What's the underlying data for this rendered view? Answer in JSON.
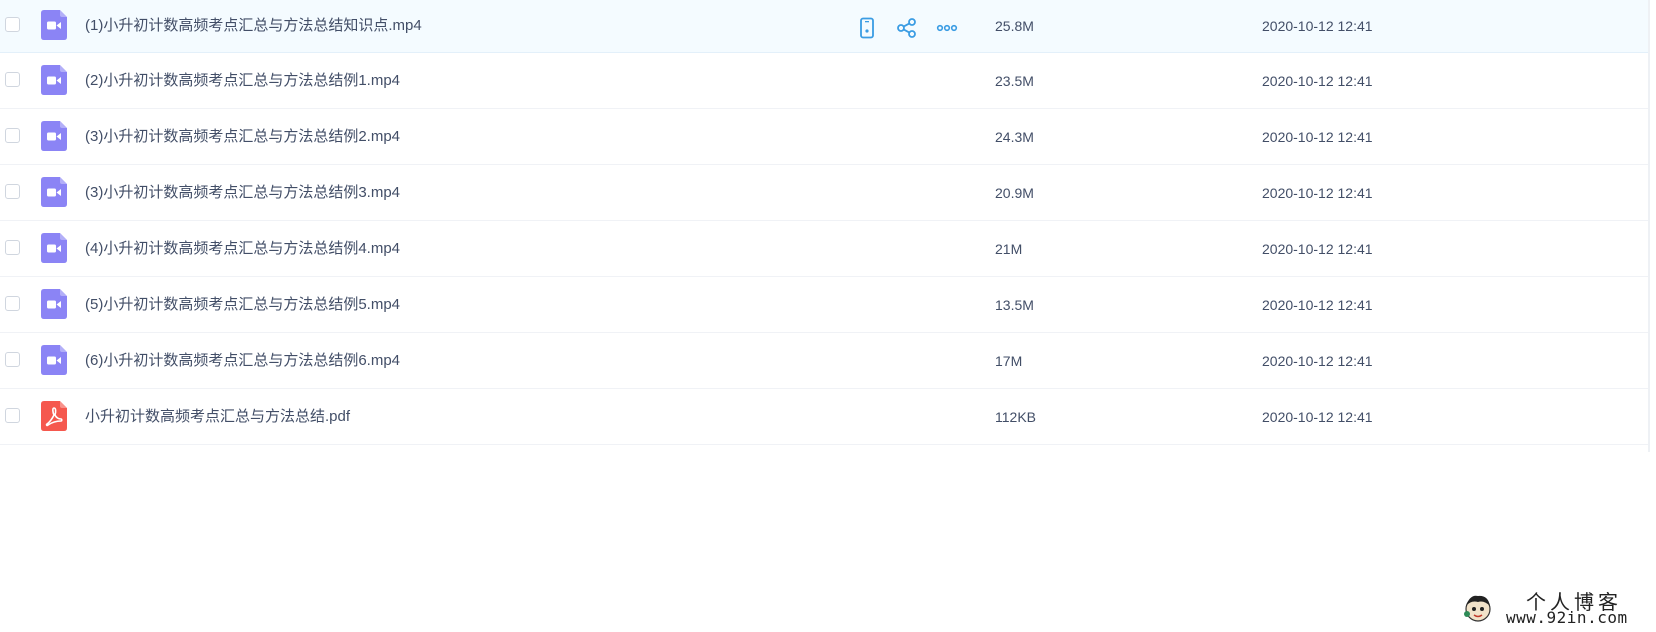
{
  "files": [
    {
      "name": "(1)小升初计数高频考点汇总与方法总结知识点.mp4",
      "size": "25.8M",
      "date": "2020-10-12 12:41",
      "type": "video",
      "hovered": true
    },
    {
      "name": "(2)小升初计数高频考点汇总与方法总结例1.mp4",
      "size": "23.5M",
      "date": "2020-10-12 12:41",
      "type": "video"
    },
    {
      "name": "(3)小升初计数高频考点汇总与方法总结例2.mp4",
      "size": "24.3M",
      "date": "2020-10-12 12:41",
      "type": "video"
    },
    {
      "name": "(3)小升初计数高频考点汇总与方法总结例3.mp4",
      "size": "20.9M",
      "date": "2020-10-12 12:41",
      "type": "video"
    },
    {
      "name": "(4)小升初计数高频考点汇总与方法总结例4.mp4",
      "size": "21M",
      "date": "2020-10-12 12:41",
      "type": "video"
    },
    {
      "name": "(5)小升初计数高频考点汇总与方法总结例5.mp4",
      "size": "13.5M",
      "date": "2020-10-12 12:41",
      "type": "video"
    },
    {
      "name": "(6)小升初计数高频考点汇总与方法总结例6.mp4",
      "size": "17M",
      "date": "2020-10-12 12:41",
      "type": "video"
    },
    {
      "name": "小升初计数高频考点汇总与方法总结.pdf",
      "size": "112KB",
      "date": "2020-10-12 12:41",
      "type": "pdf"
    }
  ],
  "row_actions": [
    {
      "icon": "phone-icon"
    },
    {
      "icon": "share-icon"
    },
    {
      "icon": "more-icon"
    }
  ],
  "watermark": {
    "title": "个人博客",
    "url": "www.92in.com"
  },
  "colors": {
    "video_icon": "#8b84f5",
    "pdf_icon": "#f5584e",
    "action_icon": "#3a9ce3",
    "hover_row": "#f4fbff",
    "text": "#424e67"
  }
}
